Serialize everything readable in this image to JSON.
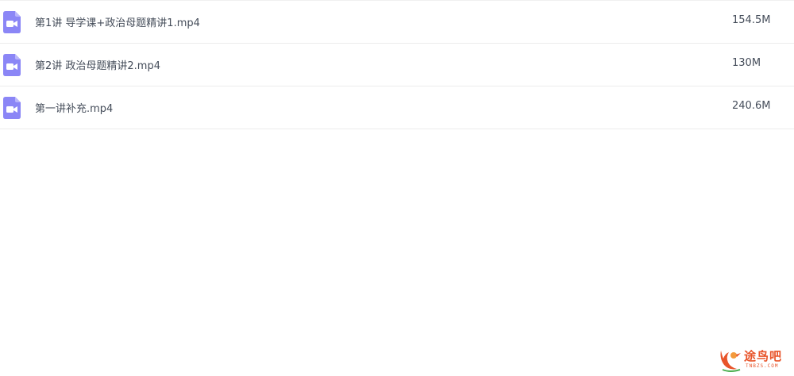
{
  "files": [
    {
      "name": "第1讲 导学课+政治母题精讲1.mp4",
      "size": "154.5M",
      "icon": "video-file-icon"
    },
    {
      "name": "第2讲 政治母题精讲2.mp4",
      "size": "130M",
      "icon": "video-file-icon"
    },
    {
      "name": "第一讲补充.mp4",
      "size": "240.6M",
      "icon": "video-file-icon"
    }
  ],
  "watermark": {
    "text": "途鸟吧",
    "sub": "TNBZS.COM"
  },
  "colors": {
    "icon": "#8b86f6",
    "text": "#454d5a",
    "divider": "#ececec",
    "watermark": "#e8542a"
  }
}
